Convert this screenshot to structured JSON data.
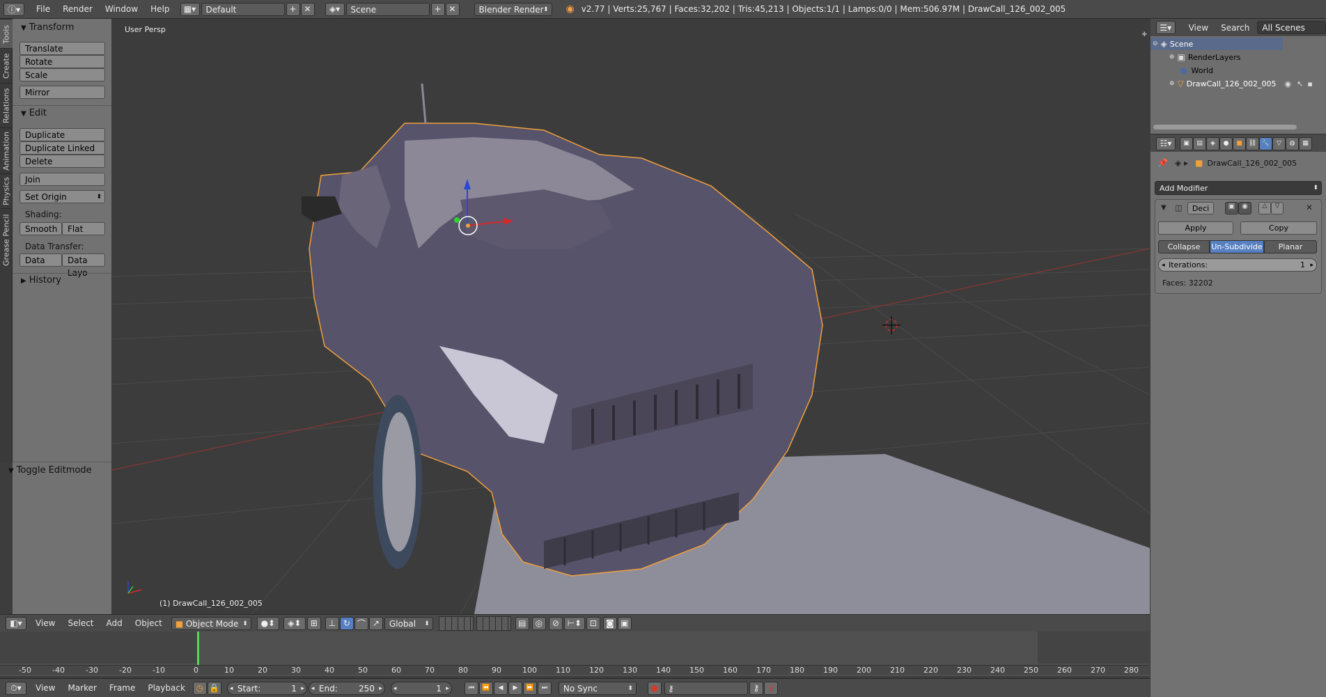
{
  "topbar": {
    "menus": [
      "File",
      "Render",
      "Window",
      "Help"
    ],
    "layout_value": "Default",
    "scene_value": "Scene",
    "engine_value": "Blender Render",
    "stats": "v2.77 | Verts:25,767 | Faces:32,202 | Tris:45,213 | Objects:1/1 | Lamps:0/0 | Mem:506.97M | DrawCall_126_002_005"
  },
  "tabs": [
    "Tools",
    "Create",
    "Relations",
    "Animation",
    "Physics",
    "Grease Pencil"
  ],
  "toolpanel": {
    "transform_title": "Transform",
    "translate": "Translate",
    "rotate": "Rotate",
    "scale": "Scale",
    "mirror": "Mirror",
    "edit_title": "Edit",
    "duplicate": "Duplicate",
    "duplicate_linked": "Duplicate Linked",
    "delete": "Delete",
    "join": "Join",
    "set_origin": "Set Origin",
    "shading_label": "Shading:",
    "smooth": "Smooth",
    "flat": "Flat",
    "data_transfer_label": "Data Transfer:",
    "data": "Data",
    "data_layout": "Data Layo",
    "history_title": "History",
    "toggle_editmode": "Toggle Editmode"
  },
  "viewport": {
    "view_label": "User Persp",
    "object_label": "(1) DrawCall_126_002_005"
  },
  "outliner": {
    "view": "View",
    "search": "Search",
    "scope": "All Scenes",
    "items": [
      "Scene",
      "RenderLayers",
      "World",
      "DrawCall_126_002_005"
    ]
  },
  "properties": {
    "object_name": "DrawCall_126_002_005",
    "add_modifier": "Add Modifier",
    "modifier_name": "Deci",
    "apply": "Apply",
    "copy": "Copy",
    "collapse": "Collapse",
    "unsubdivide": "Un-Subdivide",
    "planar": "Planar",
    "iterations_label": "Iterations:",
    "iterations_value": "1",
    "faces": "Faces: 32202"
  },
  "view3d_header": {
    "menus": [
      "View",
      "Select",
      "Add",
      "Object"
    ],
    "mode": "Object Mode",
    "orientation": "Global"
  },
  "timeline": {
    "ticks": [
      "-50",
      "-40",
      "-30",
      "-20",
      "-10",
      "0",
      "10",
      "20",
      "30",
      "40",
      "50",
      "60",
      "70",
      "80",
      "90",
      "100",
      "110",
      "120",
      "130",
      "140",
      "150",
      "160",
      "170",
      "180",
      "190",
      "200",
      "210",
      "220",
      "230",
      "240",
      "250",
      "260",
      "270",
      "280"
    ],
    "menus": [
      "View",
      "Marker",
      "Frame",
      "Playback"
    ],
    "start_label": "Start:",
    "start_value": "1",
    "end_label": "End:",
    "end_value": "250",
    "current_frame": "1",
    "sync": "No Sync"
  },
  "colors": {
    "active_blue": "#5680c2",
    "selection_orange": "#f0a03c",
    "current_frame_green": "#5ad45a"
  }
}
